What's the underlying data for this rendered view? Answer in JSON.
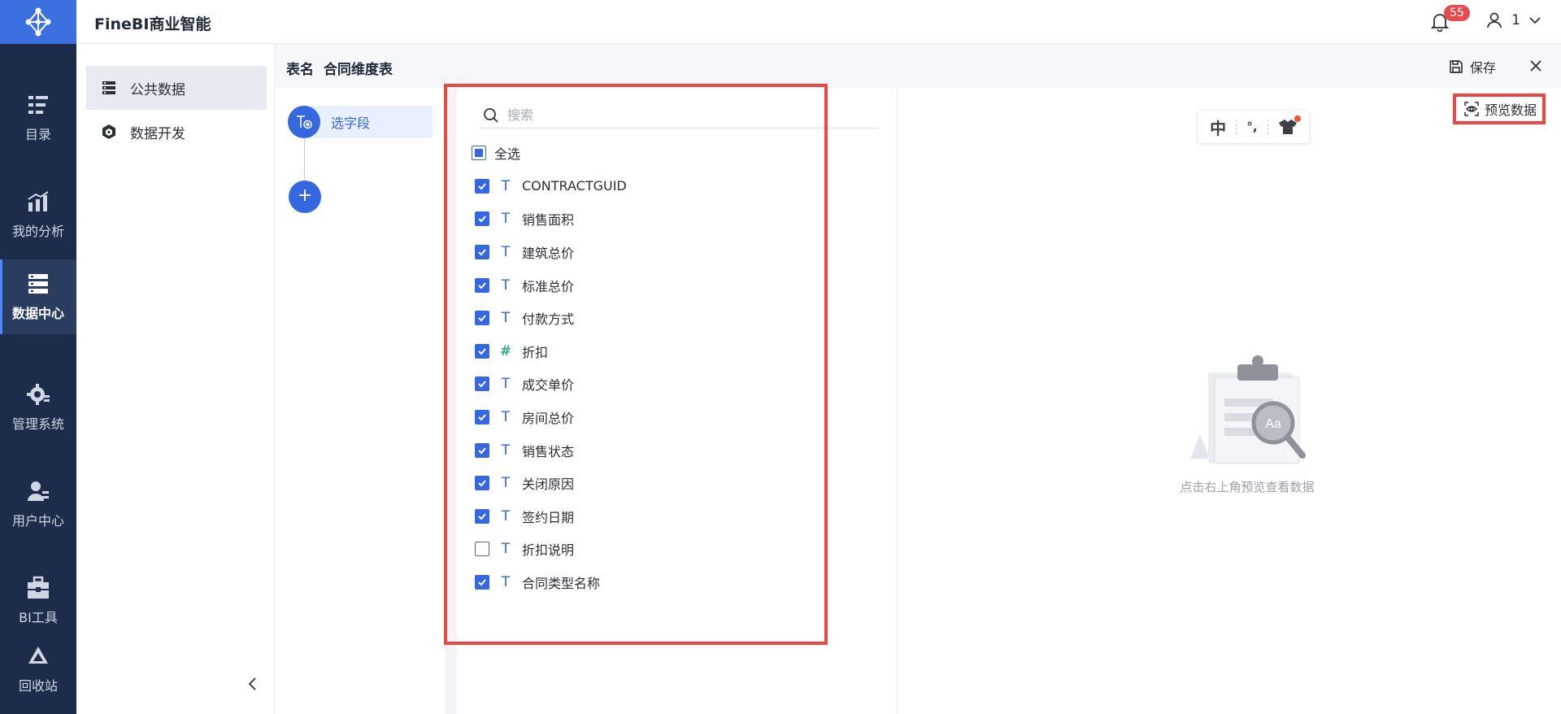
{
  "app": {
    "title": "FineBI商业智能"
  },
  "header": {
    "notification_count": "55",
    "user_label": "1"
  },
  "leftnav": {
    "items": [
      {
        "label": "目录",
        "icon": "catalog-icon",
        "active": false
      },
      {
        "label": "我的分析",
        "icon": "analysis-icon",
        "active": false
      },
      {
        "label": "数据中心",
        "icon": "data-center-icon",
        "active": true
      },
      {
        "label": "管理系统",
        "icon": "management-icon",
        "active": false
      },
      {
        "label": "用户中心",
        "icon": "user-center-icon",
        "active": false
      },
      {
        "label": "BI工具",
        "icon": "bi-tools-icon",
        "active": false
      },
      {
        "label": "回收站",
        "icon": "recycle-bin-icon",
        "active": false
      }
    ]
  },
  "subnav": {
    "items": [
      {
        "label": "公共数据",
        "icon": "public-data-icon",
        "active": true
      },
      {
        "label": "数据开发",
        "icon": "data-dev-icon",
        "active": false
      }
    ]
  },
  "main": {
    "table_label": "表名",
    "table_name": "合同维度表",
    "save_label": "保存"
  },
  "steps": {
    "select_field_label": "选字段",
    "add_label": "+"
  },
  "fields": {
    "search_placeholder": "搜索",
    "select_all_label": "全选",
    "items": [
      {
        "name": "CONTRACTGUID",
        "type": "text",
        "checked": true
      },
      {
        "name": "销售面积",
        "type": "text",
        "checked": true
      },
      {
        "name": "建筑总价",
        "type": "text",
        "checked": true
      },
      {
        "name": "标准总价",
        "type": "text",
        "checked": true
      },
      {
        "name": "付款方式",
        "type": "text",
        "checked": true
      },
      {
        "name": "折扣",
        "type": "number",
        "checked": true
      },
      {
        "name": "成交单价",
        "type": "text",
        "checked": true
      },
      {
        "name": "房间总价",
        "type": "text",
        "checked": true
      },
      {
        "name": "销售状态",
        "type": "text",
        "checked": true
      },
      {
        "name": "关闭原因",
        "type": "text",
        "checked": true
      },
      {
        "name": "签约日期",
        "type": "text",
        "checked": true
      },
      {
        "name": "折扣说明",
        "type": "text",
        "checked": false
      },
      {
        "name": "合同类型名称",
        "type": "text",
        "checked": true
      }
    ]
  },
  "preview": {
    "button_label": "预览数据",
    "empty_text": "点击右上角预览查看数据",
    "toolbar": {
      "lang_char": "中",
      "punct_char": "°,"
    }
  },
  "colors": {
    "accent": "#3567e0",
    "nav_bg": "#1c2c4a",
    "highlight": "#ee4545",
    "number_type": "#2fb394"
  }
}
